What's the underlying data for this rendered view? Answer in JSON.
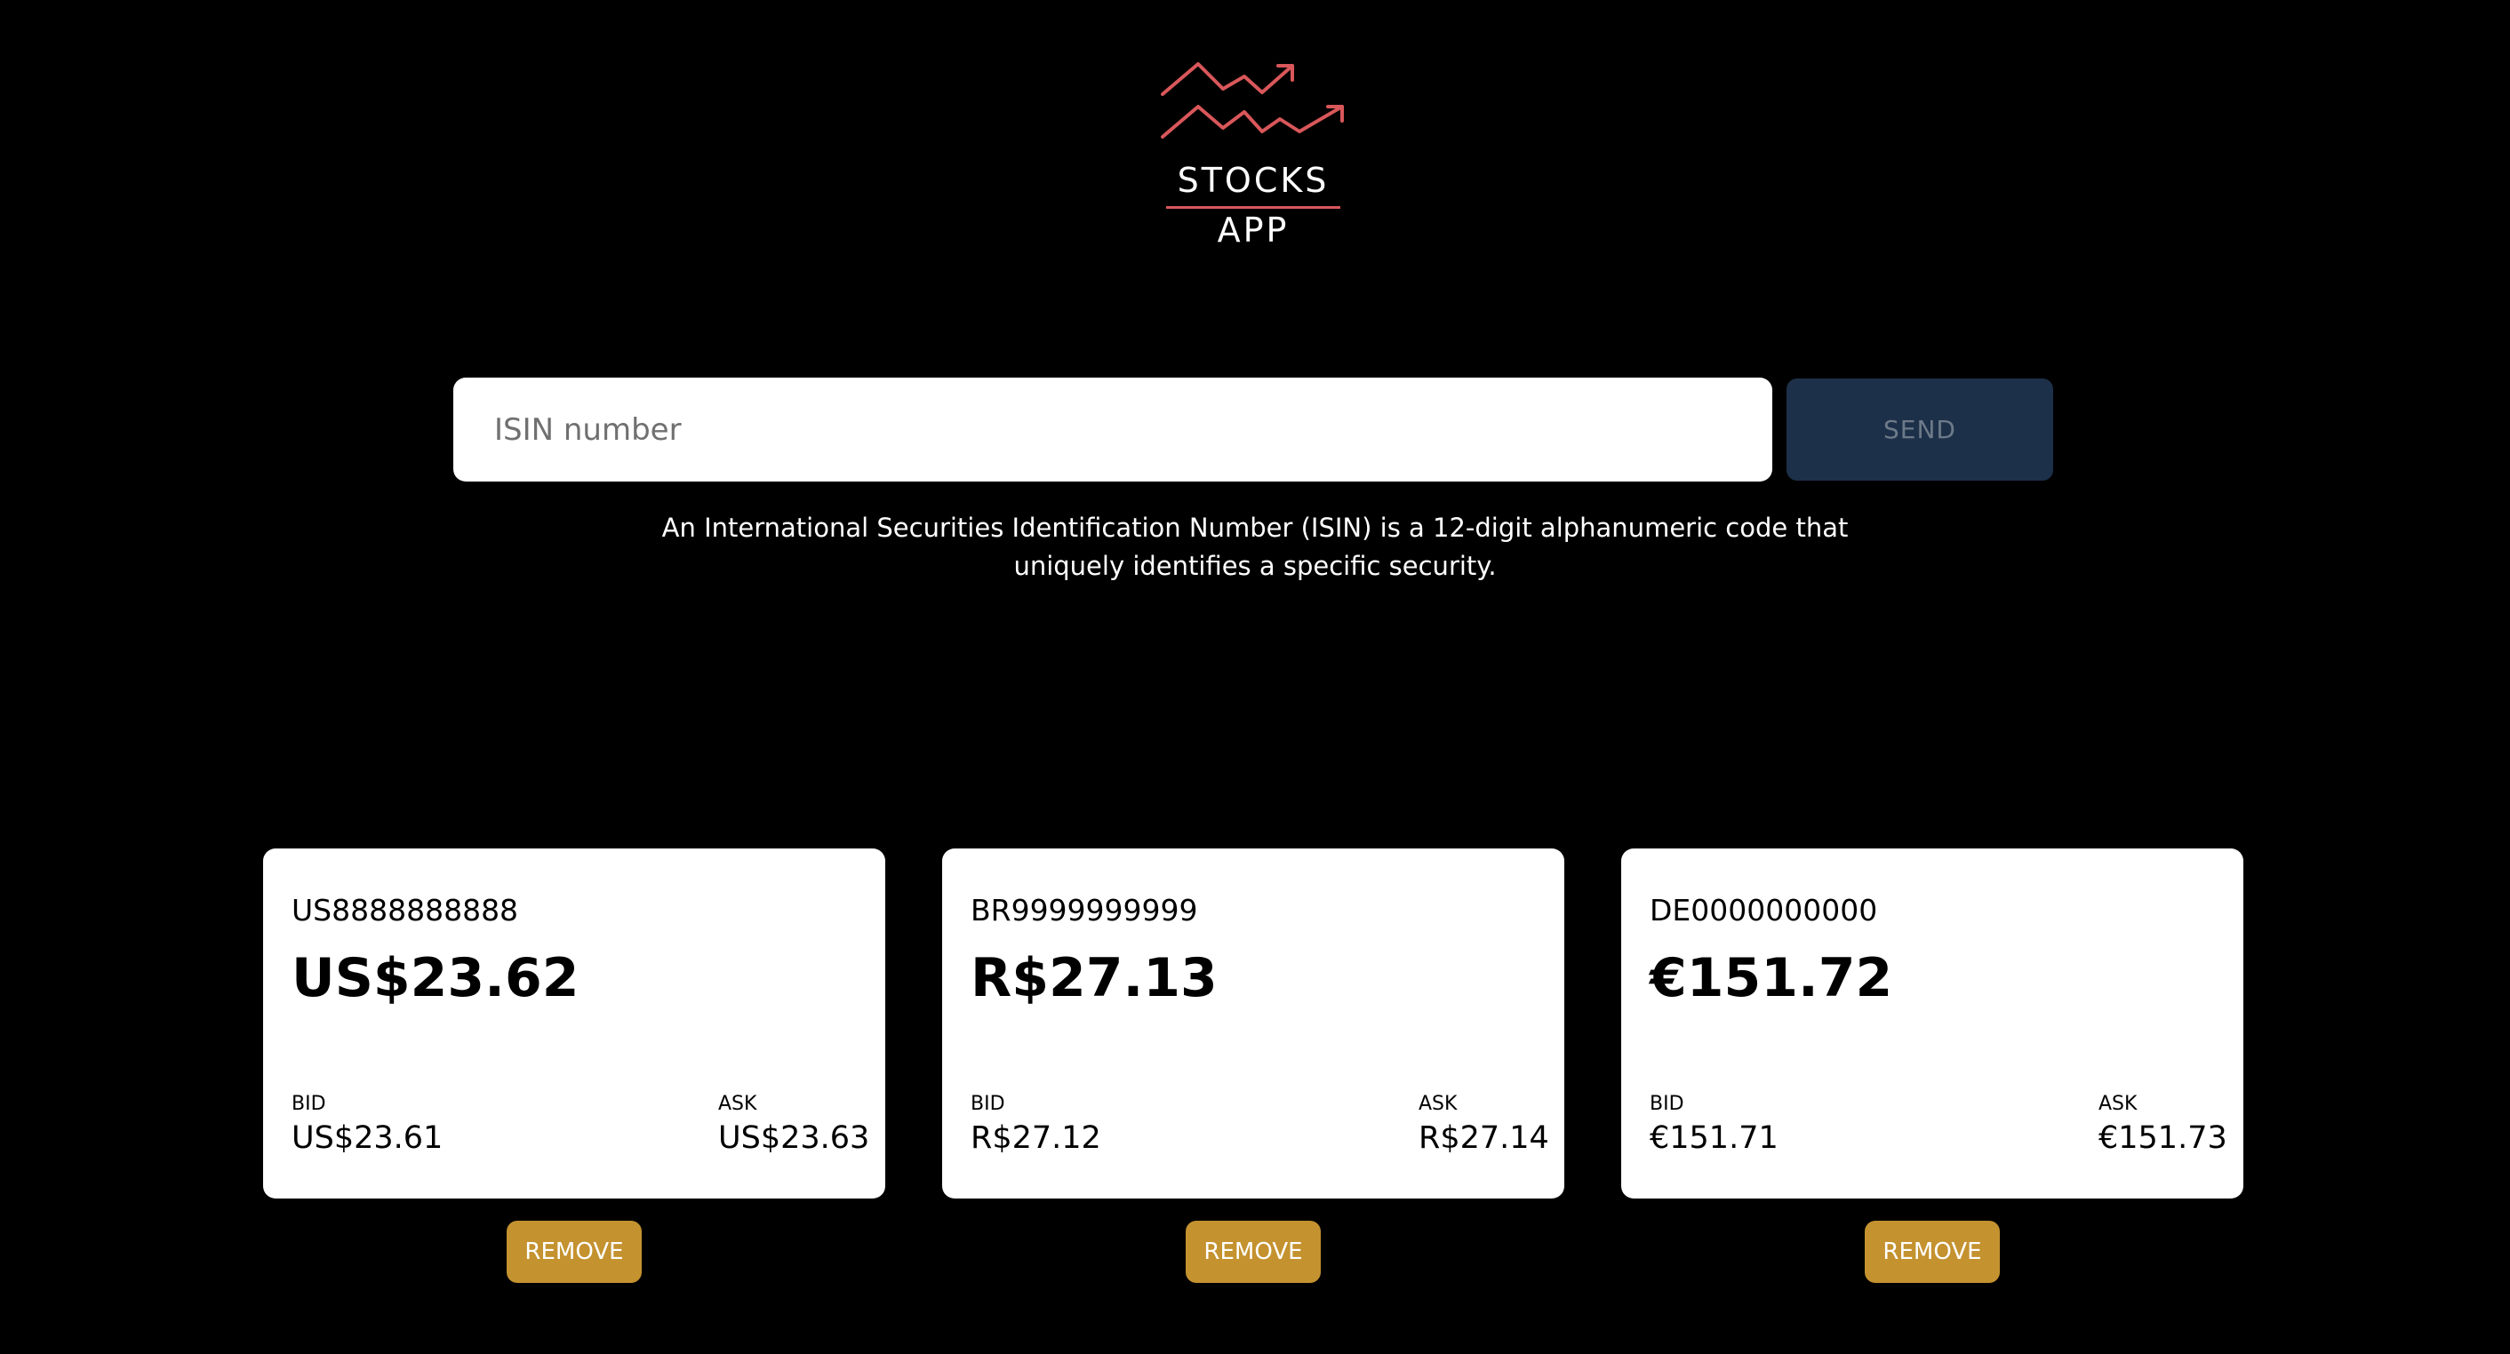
{
  "brand": {
    "word_1": "STOCKS",
    "word_2": "APP",
    "accent_color": "#d9575a"
  },
  "search": {
    "placeholder": "ISIN number",
    "value": "",
    "send_label": "SEND",
    "helper_text": "An International Securities Identification Number (ISIN) is a 12-digit alphanumeric code that uniquely identifies a specific security."
  },
  "colors": {
    "background": "#000000",
    "send_button": "#1d3049",
    "remove_button": "#c4922f"
  },
  "cards": [
    {
      "isin": "US8888888888",
      "price": "US$23.62",
      "bid_label": "BID",
      "bid": "US$23.61",
      "ask_label": "ASK",
      "ask": "US$23.63",
      "remove_label": "REMOVE"
    },
    {
      "isin": "BR9999999999",
      "price": "R$27.13",
      "bid_label": "BID",
      "bid": "R$27.12",
      "ask_label": "ASK",
      "ask": "R$27.14",
      "remove_label": "REMOVE"
    },
    {
      "isin": "DE0000000000",
      "price": "€151.72",
      "bid_label": "BID",
      "bid": "€151.71",
      "ask_label": "ASK",
      "ask": "€151.73",
      "remove_label": "REMOVE"
    }
  ]
}
